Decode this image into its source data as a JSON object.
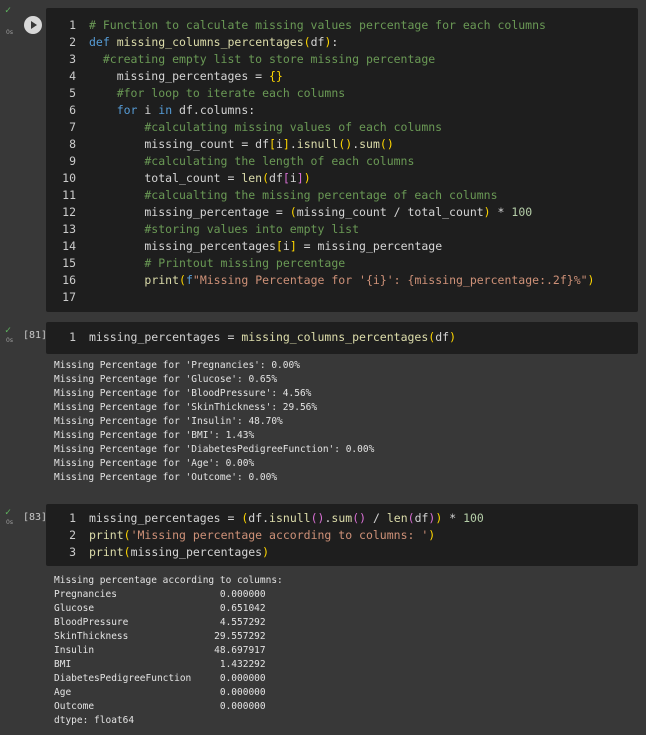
{
  "cells": [
    {
      "status": {
        "check": "✓",
        "time": "0s",
        "exec_count": ""
      },
      "line_numbers": [
        "1",
        "2",
        "3",
        "4",
        "5",
        "6",
        "7",
        "8",
        "9",
        "10",
        "11",
        "12",
        "13",
        "14",
        "15",
        "16",
        "17"
      ],
      "code_lines": [
        "# Function to calculate missing values percentage for each columns",
        "def missing_columns_percentages(df):",
        "  #creating empty list to store missing percentage",
        "    missing_percentages = {}",
        "    #for loop to iterate each columns",
        "    for i in df.columns:",
        "        #calculating missing values of each columns",
        "        missing_count = df[i].isnull().sum()",
        "        #calculating the length of each columns",
        "        total_count = len(df[i])",
        "        #calcualting the missing percentage of each columns",
        "        missing_percentage = (missing_count / total_count) * 100",
        "        #storing values into empty list",
        "        missing_percentages[i] = missing_percentage",
        "        # Printout missing percentage",
        "        print(f\"Missing Percentage for '{i}': {missing_percentage:.2f}%\")",
        ""
      ]
    },
    {
      "status": {
        "check": "✓",
        "time": "0s",
        "exec_count": "[81]"
      },
      "line_numbers": [
        "1"
      ],
      "code_lines": [
        "missing_percentages = missing_columns_percentages(df)"
      ],
      "output_lines": [
        "Missing Percentage for 'Pregnancies': 0.00%",
        "Missing Percentage for 'Glucose': 0.65%",
        "Missing Percentage for 'BloodPressure': 4.56%",
        "Missing Percentage for 'SkinThickness': 29.56%",
        "Missing Percentage for 'Insulin': 48.70%",
        "Missing Percentage for 'BMI': 1.43%",
        "Missing Percentage for 'DiabetesPedigreeFunction': 0.00%",
        "Missing Percentage for 'Age': 0.00%",
        "Missing Percentage for 'Outcome': 0.00%"
      ]
    },
    {
      "status": {
        "check": "✓",
        "time": "0s",
        "exec_count": "[83]"
      },
      "line_numbers": [
        "1",
        "2",
        "3"
      ],
      "code_lines": [
        "missing_percentages = (df.isnull().sum() / len(df)) * 100",
        "print('Missing percentage according to columns: ')",
        "print(missing_percentages)"
      ],
      "output_lines": [
        "Missing percentage according to columns:",
        "Pregnancies                  0.000000",
        "Glucose                      0.651042",
        "BloodPressure                4.557292",
        "SkinThickness               29.557292",
        "Insulin                     48.697917",
        "BMI                          1.432292",
        "DiabetesPedigreeFunction     0.000000",
        "Age                          0.000000",
        "Outcome                      0.000000",
        "dtype: float64"
      ]
    }
  ]
}
